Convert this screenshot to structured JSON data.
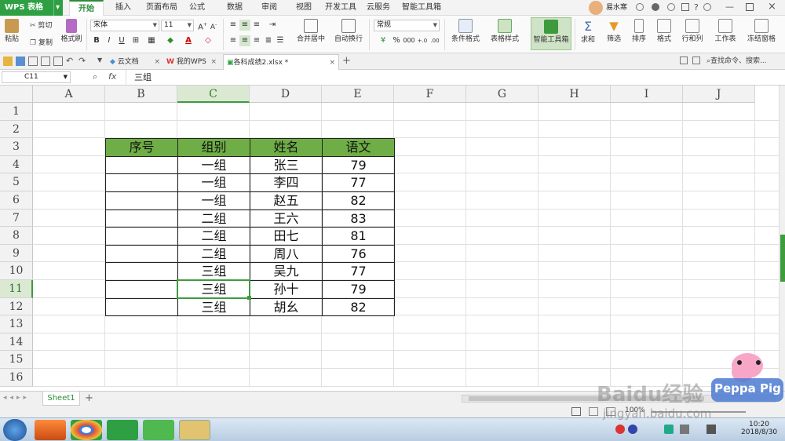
{
  "app": {
    "name": "WPS 表格"
  },
  "menu": {
    "tabs": [
      "开始",
      "插入",
      "页面布局",
      "公式",
      "数据",
      "审阅",
      "视图",
      "开发工具",
      "云服务",
      "智能工具箱"
    ],
    "active": "开始"
  },
  "user": {
    "name": "易水寒"
  },
  "ribbon": {
    "paste": "粘贴",
    "cut": "剪切",
    "copy": "复制",
    "format_painter": "格式刷",
    "font_name": "宋体",
    "font_size": "11",
    "merge_center": "合并居中",
    "wrap_text": "自动换行",
    "number_format": "常规",
    "conditional_format": "条件格式",
    "table_style": "表格样式",
    "smart_toolbox": "智能工具箱",
    "sum": "求和",
    "filter": "筛选",
    "sort": "排序",
    "format": "格式",
    "row_col": "行和列",
    "worksheet": "工作表",
    "freeze": "冻结窗格",
    "pct": "%",
    "comma": "000",
    "dec_inc": "+.0",
    "dec_dec": ".00"
  },
  "tabs": {
    "cloud_docs": "云文档",
    "my_wps": "我的WPS",
    "file": "各科成绩2.xlsx *",
    "search": "查找命令、搜索..."
  },
  "formula": {
    "cell_ref": "C11",
    "fx": "fx",
    "value": "三组"
  },
  "columns": [
    "A",
    "B",
    "C",
    "D",
    "E",
    "F",
    "G",
    "H",
    "I",
    "J"
  ],
  "rows": [
    "1",
    "2",
    "3",
    "4",
    "5",
    "6",
    "7",
    "8",
    "9",
    "10",
    "11",
    "12",
    "13",
    "14",
    "15",
    "16"
  ],
  "table": {
    "headers": [
      "序号",
      "组别",
      "姓名",
      "语文"
    ],
    "rows": [
      [
        "",
        "一组",
        "张三",
        "79"
      ],
      [
        "",
        "一组",
        "李四",
        "77"
      ],
      [
        "",
        "一组",
        "赵五",
        "82"
      ],
      [
        "",
        "二组",
        "王六",
        "83"
      ],
      [
        "",
        "二组",
        "田七",
        "81"
      ],
      [
        "",
        "二组",
        "周八",
        "76"
      ],
      [
        "",
        "三组",
        "吴九",
        "77"
      ],
      [
        "",
        "三组",
        "孙十",
        "79"
      ],
      [
        "",
        "三组",
        "胡幺",
        "82"
      ]
    ]
  },
  "sheet": {
    "name": "Sheet1",
    "add": "+"
  },
  "status": {
    "zoom": "100%"
  },
  "taskbar": {
    "time": "10:20",
    "date": "2018/8/30"
  },
  "watermark": {
    "baidu": "Baidu经验",
    "url": "jingyan.baidu.com",
    "peppa": "Peppa Pig"
  },
  "colors": {
    "header_green": "#6fae46",
    "wps_green": "#2ea043",
    "selection": "#3e9b3e"
  }
}
